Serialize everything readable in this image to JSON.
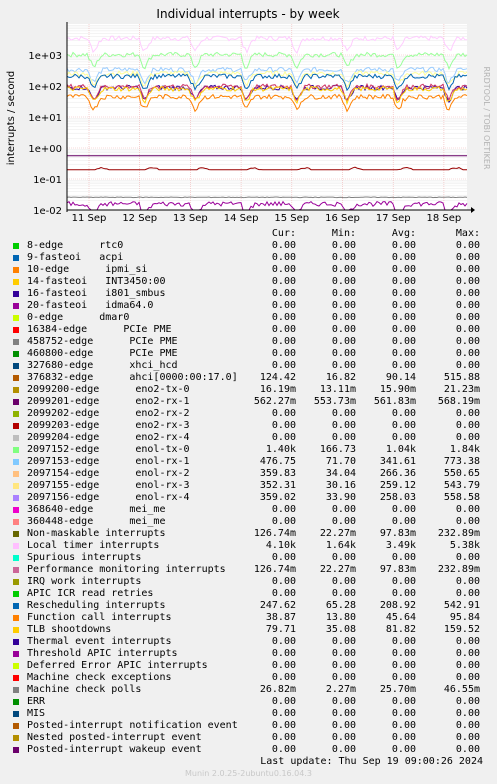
{
  "chart_data": {
    "type": "line",
    "title": "Individual interrupts - by week",
    "ylabel": "interrupts / second",
    "watermark": "RRDTOOL / TOBI OETIKER",
    "yscale": "log",
    "ylim": [
      0.01,
      10000
    ],
    "y_ticks": [
      {
        "value": 0.01,
        "label": "1e-02"
      },
      {
        "value": 0.1,
        "label": "1e-01"
      },
      {
        "value": 1,
        "label": "1e+00"
      },
      {
        "value": 10,
        "label": "1e+01"
      },
      {
        "value": 100,
        "label": "1e+02"
      },
      {
        "value": 1000,
        "label": "1e+03"
      }
    ],
    "x_ticks": [
      "11 Sep",
      "12 Sep",
      "13 Sep",
      "14 Sep",
      "15 Sep",
      "16 Sep",
      "17 Sep",
      "18 Sep"
    ],
    "grid": true,
    "series": [
      {
        "name": "Local timer interrupts",
        "color": "#ffccff",
        "avg": 3490
      },
      {
        "name": "enol-rx-0",
        "color": "#99ff99",
        "avg": 1040
      },
      {
        "name": "enol-rx-1",
        "color": "#99ccff",
        "avg": 341.61
      },
      {
        "name": "enol-rx-3",
        "color": "#ffff99",
        "avg": 259.12
      },
      {
        "name": "Rescheduling interrupts",
        "color": "#0066b3",
        "avg": 208.92
      },
      {
        "name": "ahci[0000:00:17.0]",
        "color": "#330099",
        "avg": 90.14
      },
      {
        "name": "Performance monitoring interrupts",
        "color": "#cc3366",
        "avg": 97.83
      },
      {
        "name": "TLB shootdowns",
        "color": "#ffcc00",
        "avg": 81.82
      },
      {
        "name": "Function call interrupts",
        "color": "#ff8000",
        "avg": 45.64
      },
      {
        "name": "Non-maskable interrupts",
        "color": "#990000",
        "avg": 1.05
      },
      {
        "name": "eno2-rx-1",
        "color": "#660066",
        "avg": 0.562
      },
      {
        "name": "Machine check polls",
        "color": "#808080",
        "avg": 0.0257
      },
      {
        "name": "eno2-tx-0",
        "color": "#990099",
        "avg": 0.0159
      }
    ]
  },
  "legend": {
    "headers": {
      "cur": "Cur:",
      "min": "Min:",
      "avg": "Avg:",
      "max": "Max:"
    },
    "rows": [
      {
        "label": "8-edge      rtc0",
        "color": "#00cc00",
        "cur": "0.00",
        "min": "0.00",
        "avg": "0.00",
        "max": "0.00"
      },
      {
        "label": "9-fasteoi   acpi",
        "color": "#0066b3",
        "cur": "0.00",
        "min": "0.00",
        "avg": "0.00",
        "max": "0.00"
      },
      {
        "label": "10-edge      ipmi_si",
        "color": "#ff8000",
        "cur": "0.00",
        "min": "0.00",
        "avg": "0.00",
        "max": "0.00"
      },
      {
        "label": "14-fasteoi   INT3450:00",
        "color": "#ffcc00",
        "cur": "0.00",
        "min": "0.00",
        "avg": "0.00",
        "max": "0.00"
      },
      {
        "label": "16-fasteoi   i801_smbus",
        "color": "#330099",
        "cur": "0.00",
        "min": "0.00",
        "avg": "0.00",
        "max": "0.00"
      },
      {
        "label": "20-fasteoi   idma64.0",
        "color": "#990099",
        "cur": "0.00",
        "min": "0.00",
        "avg": "0.00",
        "max": "0.00"
      },
      {
        "label": "0-edge      dmar0",
        "color": "#ccff00",
        "cur": "0.00",
        "min": "0.00",
        "avg": "0.00",
        "max": "0.00"
      },
      {
        "label": "16384-edge      PCIe PME",
        "color": "#ff0000",
        "cur": "0.00",
        "min": "0.00",
        "avg": "0.00",
        "max": "0.00"
      },
      {
        "label": "458752-edge      PCIe PME",
        "color": "#808080",
        "cur": "0.00",
        "min": "0.00",
        "avg": "0.00",
        "max": "0.00"
      },
      {
        "label": "460800-edge      PCIe PME",
        "color": "#008f00",
        "cur": "0.00",
        "min": "0.00",
        "avg": "0.00",
        "max": "0.00"
      },
      {
        "label": "327680-edge      xhci_hcd",
        "color": "#00487d",
        "cur": "0.00",
        "min": "0.00",
        "avg": "0.00",
        "max": "0.00"
      },
      {
        "label": "376832-edge      ahci[0000:00:17.0]",
        "color": "#b35a00",
        "cur": "124.42",
        "min": "16.82",
        "avg": "90.14",
        "max": "515.88"
      },
      {
        "label": "2099200-edge      eno2-tx-0",
        "color": "#b38f00",
        "cur": "16.19m",
        "min": "13.11m",
        "avg": "15.90m",
        "max": "21.23m"
      },
      {
        "label": "2099201-edge      eno2-rx-1",
        "color": "#6b006b",
        "cur": "562.27m",
        "min": "553.73m",
        "avg": "561.83m",
        "max": "568.19m"
      },
      {
        "label": "2099202-edge      eno2-rx-2",
        "color": "#8fb300",
        "cur": "0.00",
        "min": "0.00",
        "avg": "0.00",
        "max": "0.00"
      },
      {
        "label": "2099203-edge      eno2-rx-3",
        "color": "#b30000",
        "cur": "0.00",
        "min": "0.00",
        "avg": "0.00",
        "max": "0.00"
      },
      {
        "label": "2099204-edge      eno2-rx-4",
        "color": "#bebebe",
        "cur": "0.00",
        "min": "0.00",
        "avg": "0.00",
        "max": "0.00"
      },
      {
        "label": "2097152-edge      enol-tx-0",
        "color": "#80ff80",
        "cur": "1.40k",
        "min": "166.73",
        "avg": "1.04k",
        "max": "1.84k"
      },
      {
        "label": "2097153-edge      enol-rx-1",
        "color": "#80c9ff",
        "cur": "476.75",
        "min": "71.70",
        "avg": "341.61",
        "max": "773.38"
      },
      {
        "label": "2097154-edge      enol-rx-2",
        "color": "#ffc080",
        "cur": "359.83",
        "min": "34.04",
        "avg": "266.36",
        "max": "550.65"
      },
      {
        "label": "2097155-edge      enol-rx-3",
        "color": "#ffe680",
        "cur": "352.31",
        "min": "30.16",
        "avg": "259.12",
        "max": "543.79"
      },
      {
        "label": "2097156-edge      enol-rx-4",
        "color": "#aa80ff",
        "cur": "359.02",
        "min": "33.90",
        "avg": "258.03",
        "max": "558.58"
      },
      {
        "label": "368640-edge      mei_me",
        "color": "#ee00cc",
        "cur": "0.00",
        "min": "0.00",
        "avg": "0.00",
        "max": "0.00"
      },
      {
        "label": "360448-edge      mei_me",
        "color": "#ff8080",
        "cur": "0.00",
        "min": "0.00",
        "avg": "0.00",
        "max": "0.00"
      },
      {
        "label": "Non-maskable interrupts",
        "color": "#666600",
        "cur": "126.74m",
        "min": "22.27m",
        "avg": "97.83m",
        "max": "232.89m"
      },
      {
        "label": "Local timer interrupts",
        "color": "#ffbfff",
        "cur": "4.10k",
        "min": "1.64k",
        "avg": "3.49k",
        "max": "5.38k"
      },
      {
        "label": "Spurious interrupts",
        "color": "#00ffcc",
        "cur": "0.00",
        "min": "0.00",
        "avg": "0.00",
        "max": "0.00"
      },
      {
        "label": "Performance monitoring interrupts",
        "color": "#cc6699",
        "cur": "126.74m",
        "min": "22.27m",
        "avg": "97.83m",
        "max": "232.89m"
      },
      {
        "label": "IRQ work interrupts",
        "color": "#999900",
        "cur": "0.00",
        "min": "0.00",
        "avg": "0.00",
        "max": "0.00"
      },
      {
        "label": "APIC ICR read retries",
        "color": "#00cc00",
        "cur": "0.00",
        "min": "0.00",
        "avg": "0.00",
        "max": "0.00"
      },
      {
        "label": "Rescheduling interrupts",
        "color": "#0066b3",
        "cur": "247.62",
        "min": "65.28",
        "avg": "208.92",
        "max": "542.91"
      },
      {
        "label": "Function call interrupts",
        "color": "#ff8000",
        "cur": "38.87",
        "min": "13.80",
        "avg": "45.64",
        "max": "95.84"
      },
      {
        "label": "TLB shootdowns",
        "color": "#ffcc00",
        "cur": "79.71",
        "min": "35.08",
        "avg": "81.82",
        "max": "159.52"
      },
      {
        "label": "Thermal event interrupts",
        "color": "#330099",
        "cur": "0.00",
        "min": "0.00",
        "avg": "0.00",
        "max": "0.00"
      },
      {
        "label": "Threshold APIC interrupts",
        "color": "#990099",
        "cur": "0.00",
        "min": "0.00",
        "avg": "0.00",
        "max": "0.00"
      },
      {
        "label": "Deferred Error APIC interrupts",
        "color": "#ccff00",
        "cur": "0.00",
        "min": "0.00",
        "avg": "0.00",
        "max": "0.00"
      },
      {
        "label": "Machine check exceptions",
        "color": "#ff0000",
        "cur": "0.00",
        "min": "0.00",
        "avg": "0.00",
        "max": "0.00"
      },
      {
        "label": "Machine check polls",
        "color": "#808080",
        "cur": "26.82m",
        "min": "2.27m",
        "avg": "25.70m",
        "max": "46.55m"
      },
      {
        "label": "ERR",
        "color": "#008f00",
        "cur": "0.00",
        "min": "0.00",
        "avg": "0.00",
        "max": "0.00"
      },
      {
        "label": "MIS",
        "color": "#00487d",
        "cur": "0.00",
        "min": "0.00",
        "avg": "0.00",
        "max": "0.00"
      },
      {
        "label": "Posted-interrupt notification event",
        "color": "#b35a00",
        "cur": "0.00",
        "min": "0.00",
        "avg": "0.00",
        "max": "0.00"
      },
      {
        "label": "Nested posted-interrupt event",
        "color": "#b38f00",
        "cur": "0.00",
        "min": "0.00",
        "avg": "0.00",
        "max": "0.00"
      },
      {
        "label": "Posted-interrupt wakeup event",
        "color": "#6b006b",
        "cur": "0.00",
        "min": "0.00",
        "avg": "0.00",
        "max": "0.00"
      }
    ]
  },
  "footer": {
    "last_update": "Last update:  Thu Sep 19 09:00:26 2024",
    "munin_version": "Munin 2.0.25-2ubuntu0.16.04.3"
  }
}
